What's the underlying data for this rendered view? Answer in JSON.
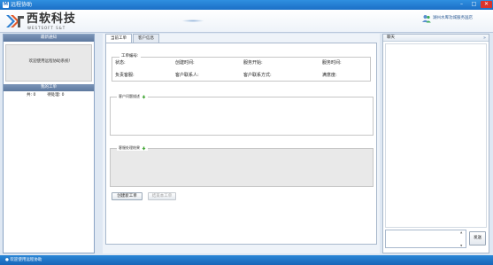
{
  "window": {
    "title": "远程协助",
    "app_icon_letter": "M",
    "controls": {
      "minimize": "–",
      "maximize": "□",
      "close": "✕"
    }
  },
  "header": {
    "logo_cn": "西软科技",
    "logo_en": "WESTSOFT S&T",
    "user_text": "湖州水库功城服务国店"
  },
  "left": {
    "notice_title": "最新通知",
    "notice_text": "欢迎使用远程协助系统!",
    "my_work_title": "我的工单",
    "count_label": "共: 0",
    "pending_label": "待处理: 0"
  },
  "main": {
    "tabs": [
      "当前工单",
      "客户信息"
    ],
    "work_order_legend": "工单编号:",
    "fields_row1": [
      "状态:",
      "创建时间:",
      "服务开始:",
      "服务时间:"
    ],
    "fields_row2": [
      "负责客服:",
      "客户联系人:",
      "客户联系方式:",
      "满意度:"
    ],
    "problem_section": "客户问题描述",
    "result_section": "客服处理结果",
    "create_button": "创建新工单",
    "finish_button": "结束本工单"
  },
  "chat": {
    "title": "聊天",
    "collapse_glyph": "»",
    "send_button": "发送",
    "scroll_up": "▲",
    "scroll_down": "▼"
  },
  "status": {
    "text": "● 欢迎使用远程协助"
  },
  "colors": {
    "titlebar": "#1b6fc6",
    "panel_header": "#6882a8",
    "close_button": "#d9342b",
    "accent_green": "#47a83a"
  }
}
